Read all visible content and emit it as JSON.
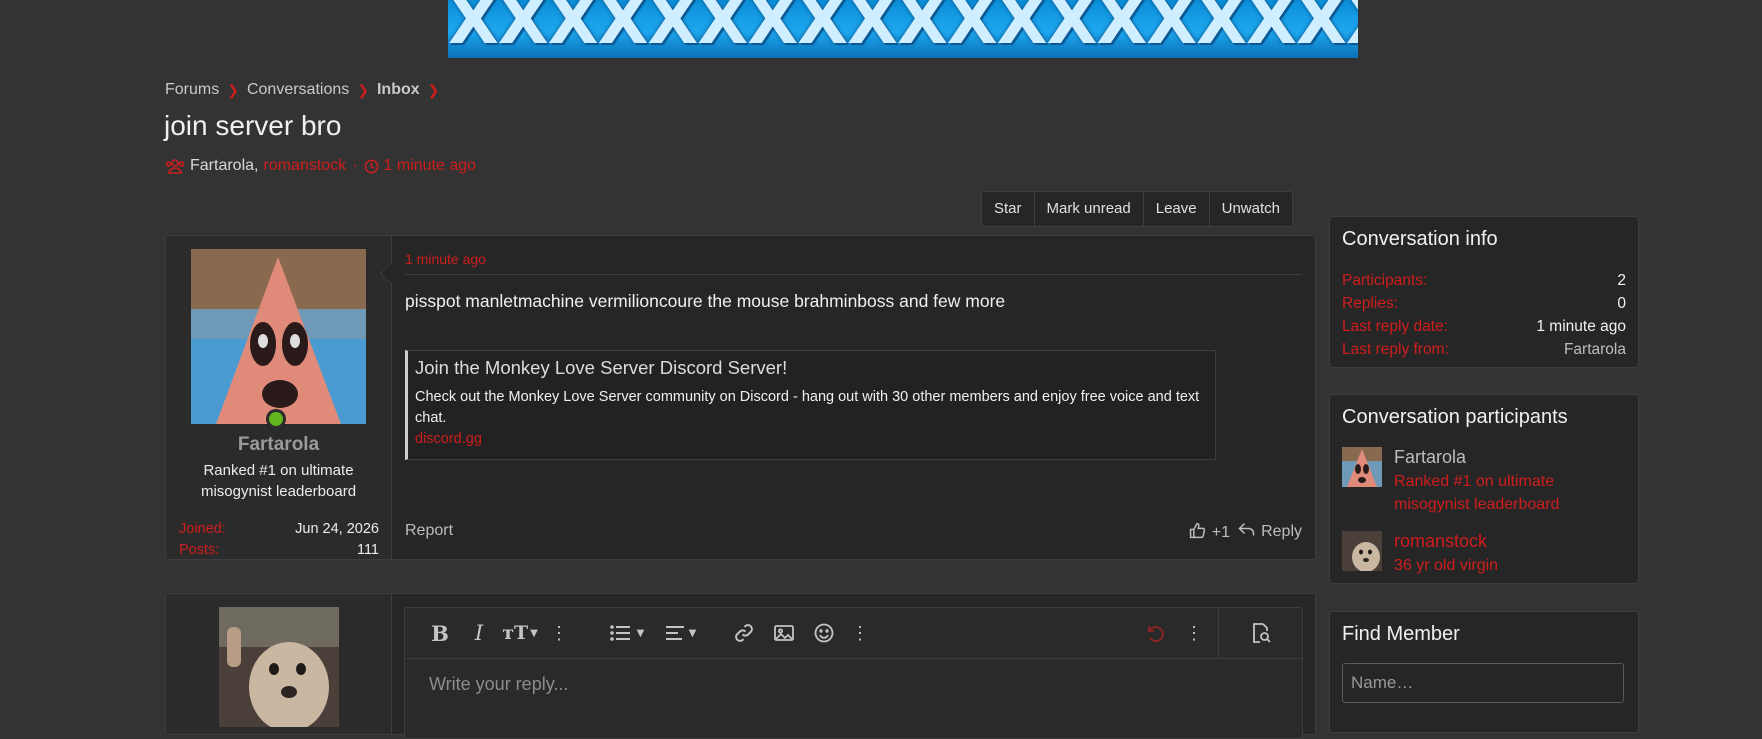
{
  "banner": {
    "text": "XXXXXXXXXXXXXXXXXXXXXXING"
  },
  "breadcrumb": [
    "Forums",
    "Conversations",
    "Inbox"
  ],
  "conversation": {
    "title": "join server bro",
    "participants": [
      "Fartarola",
      "romanstock"
    ],
    "separator": ",",
    "time": "1 minute ago"
  },
  "actions": [
    "Star",
    "Mark unread",
    "Leave",
    "Unwatch"
  ],
  "message": {
    "author": "Fartarola",
    "author_title": "Ranked #1 on ultimate misogynist leaderboard",
    "stats": [
      {
        "label": "Joined:",
        "value": "Jun 24, 2026"
      },
      {
        "label": "Posts:",
        "value": "111"
      }
    ],
    "time": "1 minute ago",
    "body": "pisspot manletmachine vermilioncoure the mouse brahminboss and few more",
    "embed": {
      "title": "Join the Monkey Love Server Discord Server!",
      "description": "Check out the Monkey Love Server community on Discord - hang out with 30 other members and enjoy free voice and text chat.",
      "link": "discord.gg"
    },
    "report_label": "Report",
    "likes": "+1",
    "reply_label": "Reply"
  },
  "editor": {
    "placeholder": "Write your reply..."
  },
  "sidebar": {
    "info": {
      "title": "Conversation info",
      "rows": [
        {
          "label": "Participants:",
          "value": "2"
        },
        {
          "label": "Replies:",
          "value": "0"
        },
        {
          "label": "Last reply date:",
          "value": "1 minute ago"
        },
        {
          "label": "Last reply from:",
          "value": "Fartarola"
        }
      ]
    },
    "participants": {
      "title": "Conversation participants",
      "items": [
        {
          "name": "Fartarola",
          "title": "Ranked #1 on ultimate misogynist leaderboard"
        },
        {
          "name": "romanstock",
          "title": "36 yr old virgin"
        }
      ]
    },
    "find_member": {
      "title": "Find Member",
      "placeholder": "Name…"
    }
  },
  "colors": {
    "accent": "#cf1d1d",
    "background": "#333333",
    "panel": "#262626",
    "online": "#63b520"
  }
}
